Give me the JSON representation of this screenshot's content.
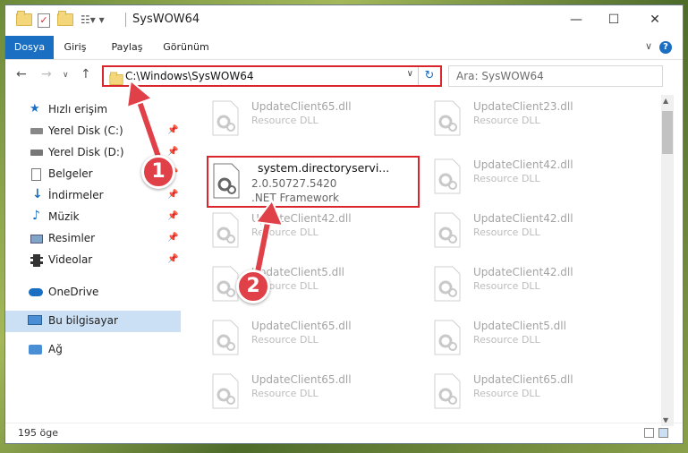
{
  "window": {
    "title": "SysWOW64",
    "controls": {
      "minimize": "—",
      "maximize": "☐",
      "close": "✕"
    }
  },
  "ribbon": {
    "tabs": [
      {
        "label": "Dosya",
        "active": true
      },
      {
        "label": "Giriş"
      },
      {
        "label": "Paylaş"
      },
      {
        "label": "Görünüm"
      }
    ]
  },
  "address": {
    "path": "C:\\Windows\\SysWOW64",
    "search_placeholder": "Ara: SysWOW64"
  },
  "sidebar": {
    "items": [
      {
        "label": "Hızlı erişim",
        "icon": "star-icon"
      },
      {
        "label": "Yerel Disk (C:)",
        "icon": "drive-icon",
        "pinned": true
      },
      {
        "label": "Yerel Disk (D:)",
        "icon": "drive-icon",
        "pinned": true
      },
      {
        "label": "Belgeler",
        "icon": "documents-icon",
        "pinned": true
      },
      {
        "label": "İndirmeler",
        "icon": "download-icon",
        "pinned": true
      },
      {
        "label": "Müzik",
        "icon": "music-icon",
        "pinned": true
      },
      {
        "label": "Resimler",
        "icon": "pictures-icon",
        "pinned": true
      },
      {
        "label": "Videolar",
        "icon": "video-icon",
        "pinned": true
      },
      {
        "label": "OneDrive",
        "icon": "cloud-icon"
      },
      {
        "label": "Bu bilgisayar",
        "icon": "computer-icon",
        "selected": true
      },
      {
        "label": "Ağ",
        "icon": "network-icon"
      }
    ]
  },
  "files": {
    "highlighted": {
      "name": "system.directoryservi...",
      "version": "2.0.50727.5420",
      "type": ".NET Framework"
    },
    "left_column": [
      {
        "name": "UpdateClient65.dll",
        "type": "Resource DLL"
      },
      {
        "name": "UpdateClient42.dll",
        "type": "Resource DLL"
      },
      {
        "name": "UpdateClient5.dll",
        "type": "Resource DLL"
      },
      {
        "name": "UpdateClient65.dll",
        "type": "Resource DLL"
      },
      {
        "name": "UpdateClient65.dll",
        "type": "Resource DLL"
      }
    ],
    "right_column": [
      {
        "name": "UpdateClient23.dll",
        "type": "Resource DLL"
      },
      {
        "name": "UpdateClient42.dll",
        "type": "Resource DLL"
      },
      {
        "name": "UpdateClient42.dll",
        "type": "Resource DLL"
      },
      {
        "name": "UpdateClient42.dll",
        "type": "Resource DLL"
      },
      {
        "name": "UpdateClient5.dll",
        "type": "Resource DLL"
      },
      {
        "name": "UpdateClient65.dll",
        "type": "Resource DLL"
      }
    ]
  },
  "status": {
    "item_count": "195 öge"
  },
  "annotations": {
    "step1": "1",
    "step2": "2"
  },
  "colors": {
    "accent": "#1a6fc3",
    "highlight": "#d9262c",
    "selection": "#cce0f5"
  }
}
